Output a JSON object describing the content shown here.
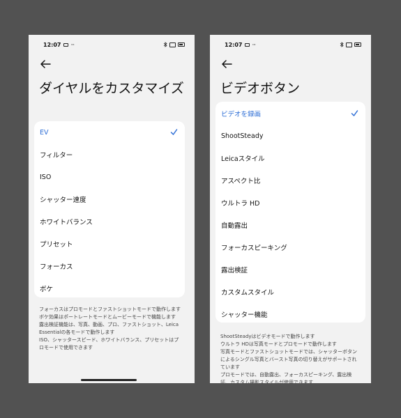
{
  "colors": {
    "accent": "#2f6fd6",
    "background": "#525252",
    "screen": "#f2f2f2",
    "card": "#ffffff"
  },
  "left": {
    "status": {
      "time": "12:07",
      "dots": "···"
    },
    "title": "ダイヤルをカスタマイズ",
    "items": [
      {
        "label": "EV",
        "selected": true
      },
      {
        "label": "フィルター"
      },
      {
        "label": "ISO"
      },
      {
        "label": "シャッター速度"
      },
      {
        "label": "ホワイトバランス"
      },
      {
        "label": "プリセット"
      },
      {
        "label": "フォーカス"
      },
      {
        "label": "ボケ"
      }
    ],
    "notes": [
      "フォーカスはプロモードとファストショットモードで動作します",
      "ボケ効果はポートレートモードとムービーモードで機能します",
      "露出検証機能は、写真、動画、プロ、ファストショット、Leica Essentialの各モードで動作します",
      "ISO、シャッタースピード、ホワイトバランス、プリセットはプロモードで使用できます"
    ]
  },
  "right": {
    "status": {
      "time": "12:07",
      "dots": "···"
    },
    "title": "ビデオボタン",
    "items": [
      {
        "label": "ビデオを録画",
        "selected": true
      },
      {
        "label": "ShootSteady"
      },
      {
        "label": "Leicaスタイル"
      },
      {
        "label": "アスペクト比"
      },
      {
        "label": "ウルトラ HD"
      },
      {
        "label": "自動露出"
      },
      {
        "label": "フォーカスピーキング"
      },
      {
        "label": "露出検証"
      },
      {
        "label": "カスタムスタイル"
      },
      {
        "label": "シャッター機能"
      }
    ],
    "notes": [
      "ShootSteadyはビデオモードで動作します",
      "ウルトラ HDは写真モードとプロモードで動作します",
      "写真モードとファストショットモードでは、シャッターボタンによるシングル写真とバースト写真の切り替えがサポートされています",
      "プロモードでは、自動露出、フォーカスピーキング、露出検証、カスタム撮影スタイルが使用できます"
    ]
  }
}
